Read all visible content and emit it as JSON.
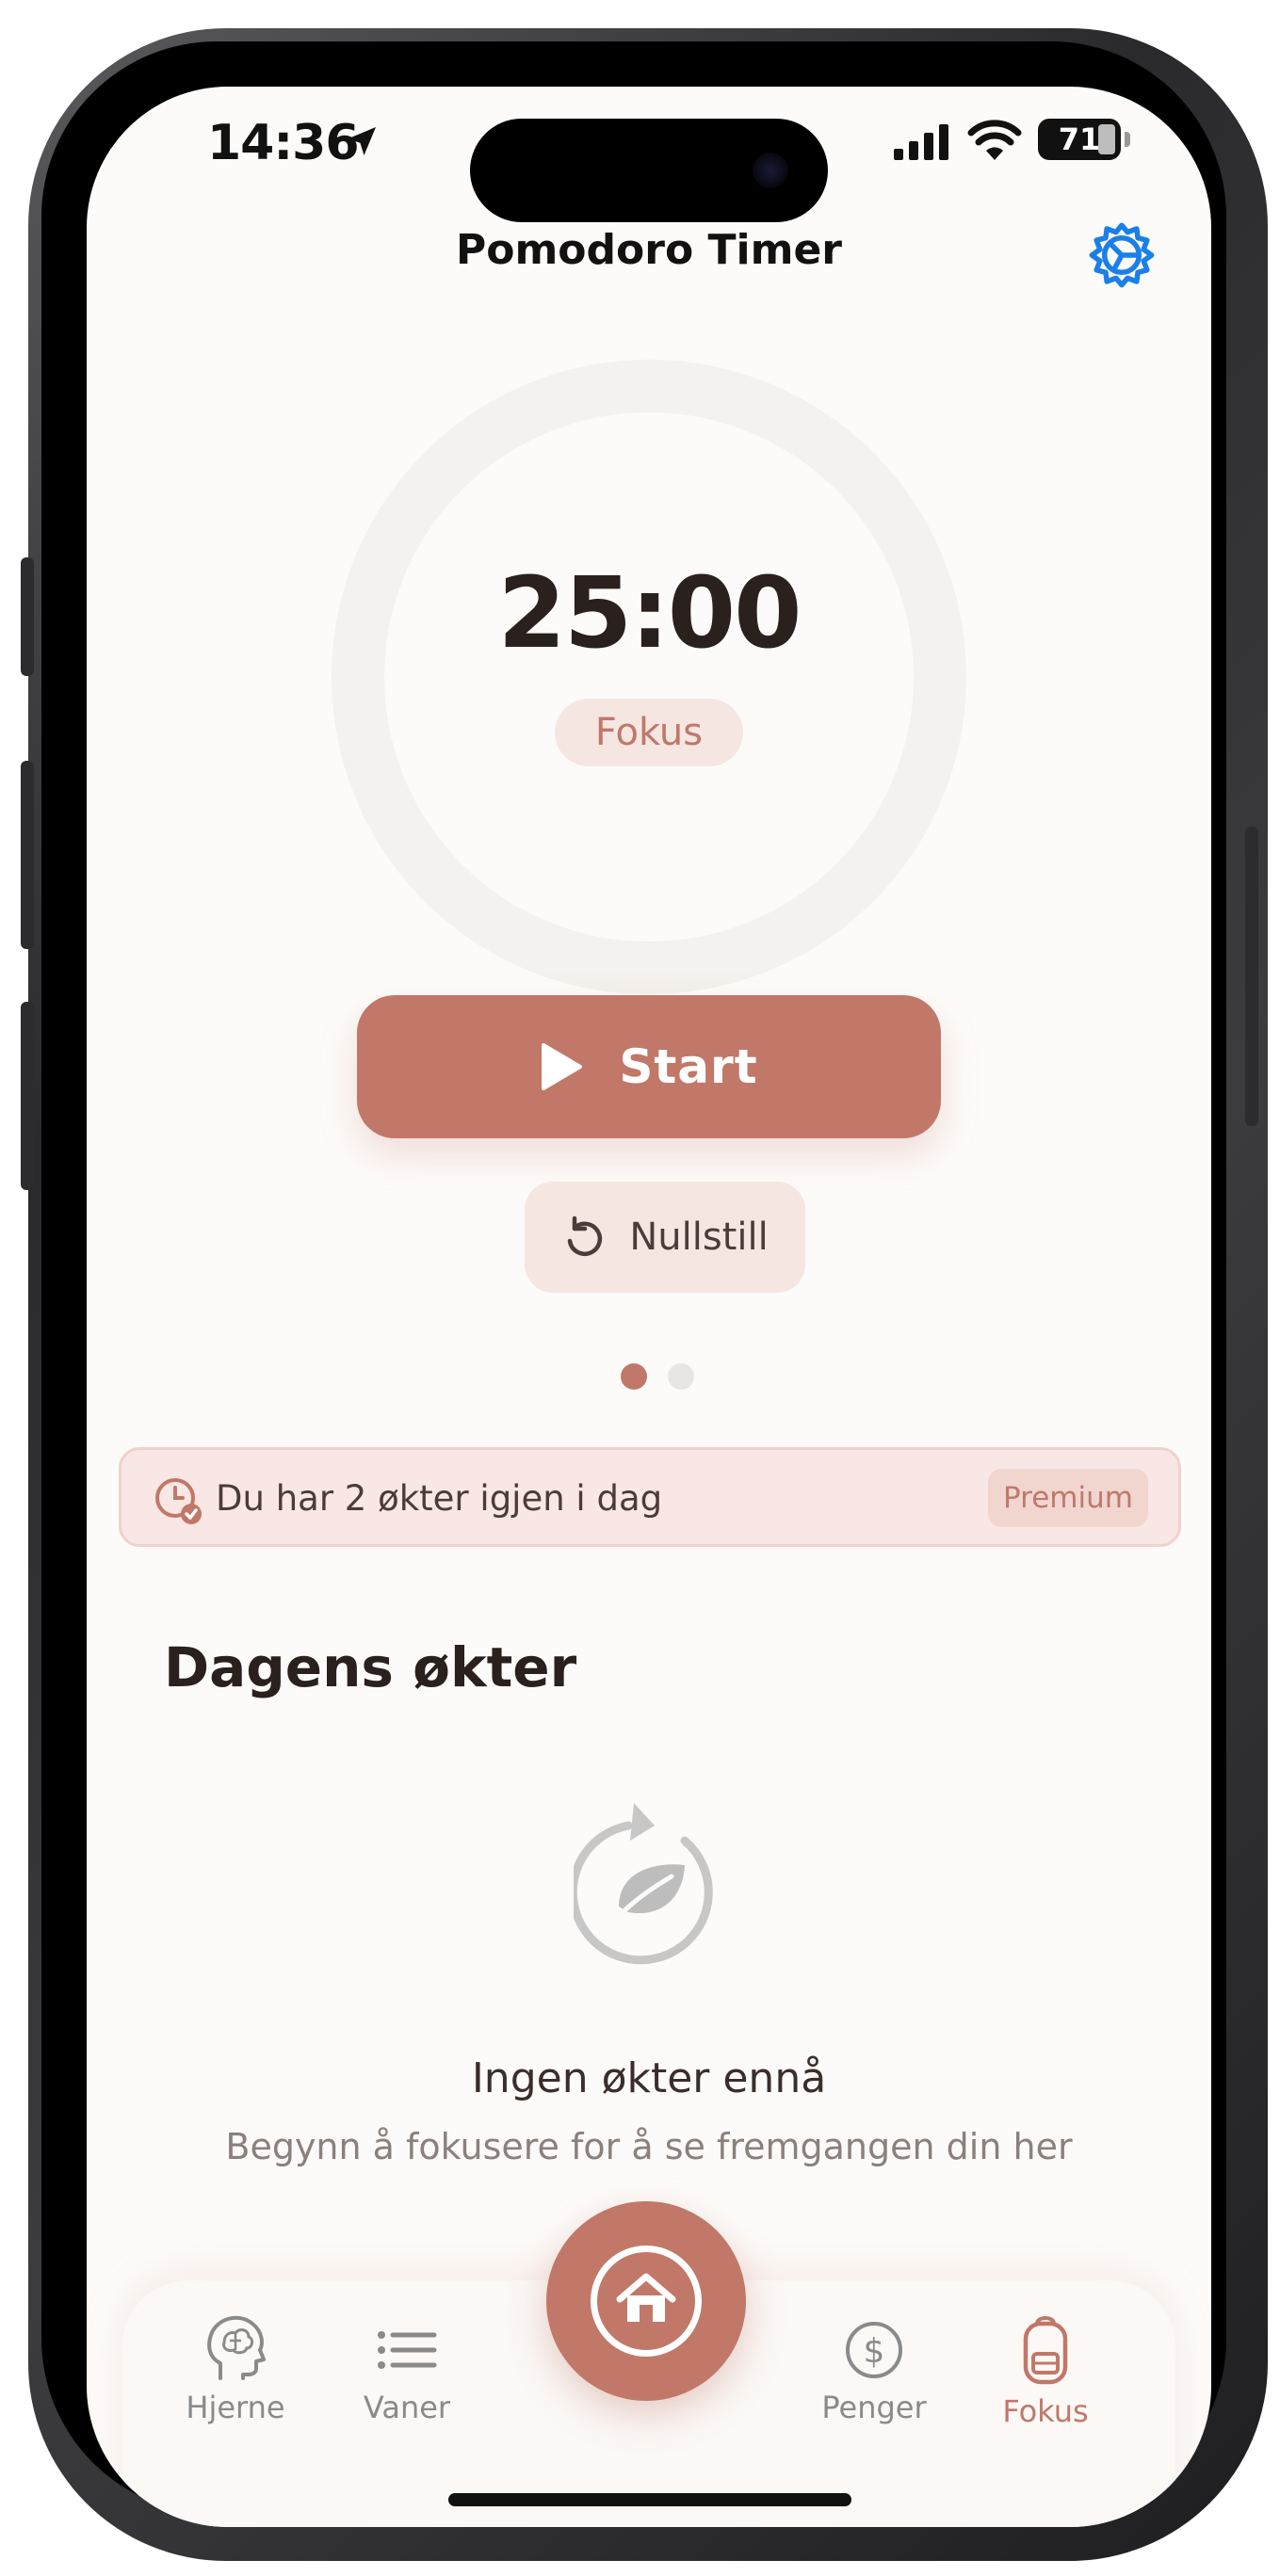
{
  "status_bar": {
    "time": "14:36",
    "battery": "71"
  },
  "header": {
    "title": "Pomodoro Timer"
  },
  "timer": {
    "time": "25:00",
    "mode": "Fokus",
    "progress": 0
  },
  "controls": {
    "start_label": "Start",
    "reset_label": "Nullstill"
  },
  "pager": {
    "current": 1,
    "total": 2
  },
  "limit_banner": {
    "text": "Du har 2 økter igjen i dag",
    "premium_label": "Premium"
  },
  "sessions": {
    "title": "Dagens økter",
    "empty_title": "Ingen økter ennå",
    "empty_subtitle": "Begynn å fokusere for å se fremgangen din her"
  },
  "tab_bar": {
    "tabs": [
      {
        "label": "Hjerne",
        "icon": "brain-head-icon"
      },
      {
        "label": "Vaner",
        "icon": "list-icon"
      },
      {
        "label": "Penger",
        "icon": "dollar-circle-icon"
      },
      {
        "label": "Fokus",
        "icon": "backpack-icon"
      }
    ],
    "center_icon": "home-icon",
    "active": "Fokus"
  },
  "colors": {
    "accent": "#c17868",
    "accent_soft": "#f6e6e2",
    "text_dark": "#2a201d",
    "settings_blue": "#1a7fe8"
  }
}
